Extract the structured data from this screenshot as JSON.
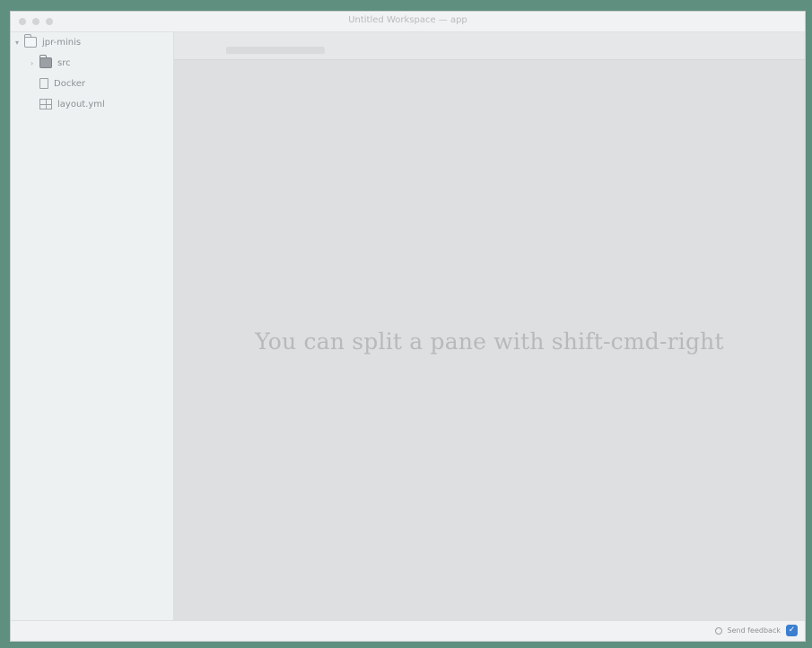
{
  "window": {
    "title": "Untitled Workspace — app"
  },
  "sidebar": {
    "items": [
      {
        "label": "jpr-minis",
        "icon": "folder-icon",
        "expanded": true
      },
      {
        "label": "src",
        "icon": "folder-icon"
      },
      {
        "label": "Docker",
        "icon": "file-icon"
      },
      {
        "label": "layout.yml",
        "icon": "grid-icon"
      }
    ]
  },
  "editor": {
    "placeholder": "You can split a pane with shift-cmd-right"
  },
  "statusbar": {
    "feedback_label": "Send feedback"
  },
  "colors": {
    "background": "#5f8f7e",
    "accent": "#3a7fd0"
  }
}
